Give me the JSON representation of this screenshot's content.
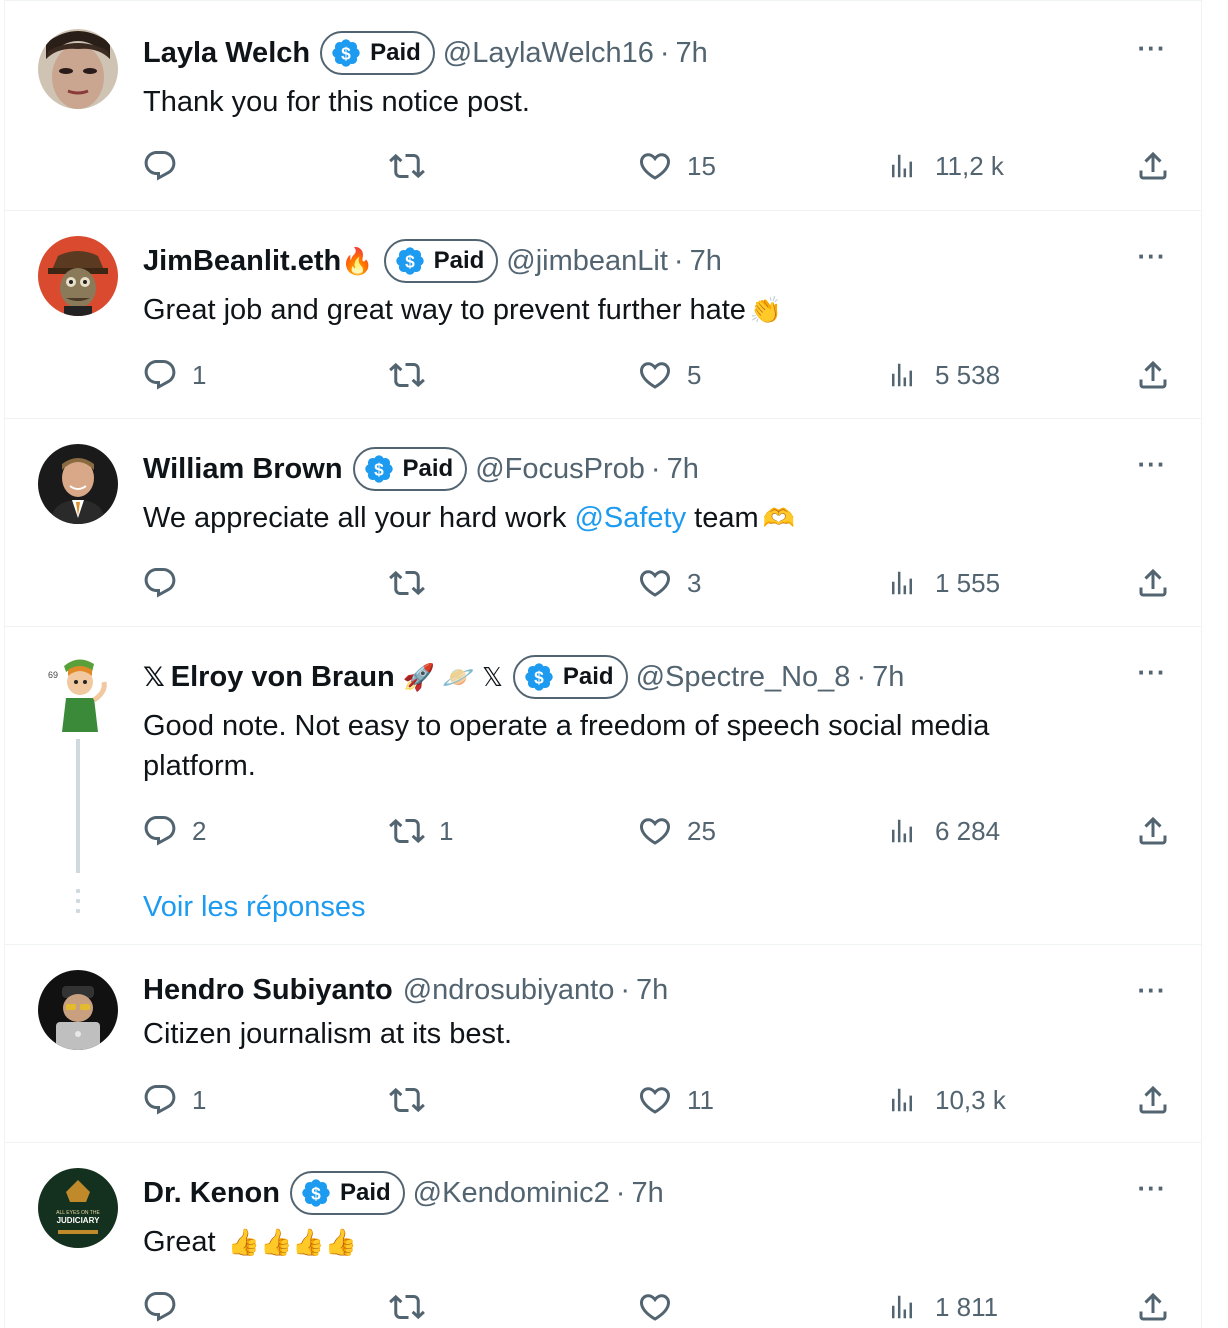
{
  "replies": [
    {
      "name": "Layla Welch",
      "name_suffix": "",
      "x_prefix": "",
      "badge": "Paid",
      "handle": "@LaylaWelch16",
      "time": "7h",
      "text_parts": [
        "Thank you for this notice post."
      ],
      "emoji": "",
      "stats": {
        "replies": "",
        "reposts": "",
        "likes": "15",
        "views": "11,2 k"
      }
    },
    {
      "name": "JimBeanlit.eth",
      "name_suffix": "🔥",
      "x_prefix": "",
      "badge": "Paid",
      "handle": "@jimbeanLit",
      "time": "7h",
      "text_parts": [
        "Great job and great way to prevent further hate"
      ],
      "emoji": "👏",
      "stats": {
        "replies": "1",
        "reposts": "",
        "likes": "5",
        "views": "5 538"
      }
    },
    {
      "name": "William Brown",
      "name_suffix": "",
      "x_prefix": "",
      "badge": "Paid",
      "handle": "@FocusProb",
      "time": "7h",
      "text_parts": [
        "We appreciate all your hard work ",
        "@Safety",
        " team"
      ],
      "emoji": "🫶",
      "stats": {
        "replies": "",
        "reposts": "",
        "likes": "3",
        "views": "1 555"
      }
    },
    {
      "name": "Elroy von Braun",
      "name_suffix": "🚀 🪐 𝕏",
      "x_prefix": "𝕏",
      "badge": "Paid",
      "handle": "@Spectre_No_8",
      "time": "7h",
      "text_parts": [
        "Good note. Not easy to operate a freedom of speech social media platform."
      ],
      "emoji": "",
      "stats": {
        "replies": "2",
        "reposts": "1",
        "likes": "25",
        "views": "6 284"
      },
      "show_replies": "Voir les réponses"
    },
    {
      "name": "Hendro Subiyanto",
      "name_suffix": "",
      "x_prefix": "",
      "badge": "",
      "handle": "@ndrosubiyanto",
      "time": "7h",
      "text_parts": [
        "Citizen journalism at its best."
      ],
      "emoji": "",
      "stats": {
        "replies": "1",
        "reposts": "",
        "likes": "11",
        "views": "10,3 k"
      }
    },
    {
      "name": "Dr. Kenon",
      "name_suffix": "",
      "x_prefix": "",
      "badge": "Paid",
      "handle": "@Kendominic2",
      "time": "7h",
      "text_parts": [
        "Great "
      ],
      "emoji": "👍👍👍👍",
      "avatar_text": [
        "ALL EYES ON THE",
        "JUDICIARY"
      ],
      "stats": {
        "replies": "",
        "reposts": "",
        "likes": "",
        "views": "1 811"
      }
    }
  ],
  "separator": "·",
  "more_glyph": "···",
  "colors": {
    "accent": "#1d9bf0",
    "muted": "#536471",
    "text": "#0f1419",
    "border": "#eff3f4"
  },
  "icons": {
    "reply": "reply-icon",
    "repost": "repost-icon",
    "like": "heart-icon",
    "views": "views-icon",
    "share": "share-icon",
    "badge": "verified-paid-badge-icon",
    "more": "more-icon"
  }
}
